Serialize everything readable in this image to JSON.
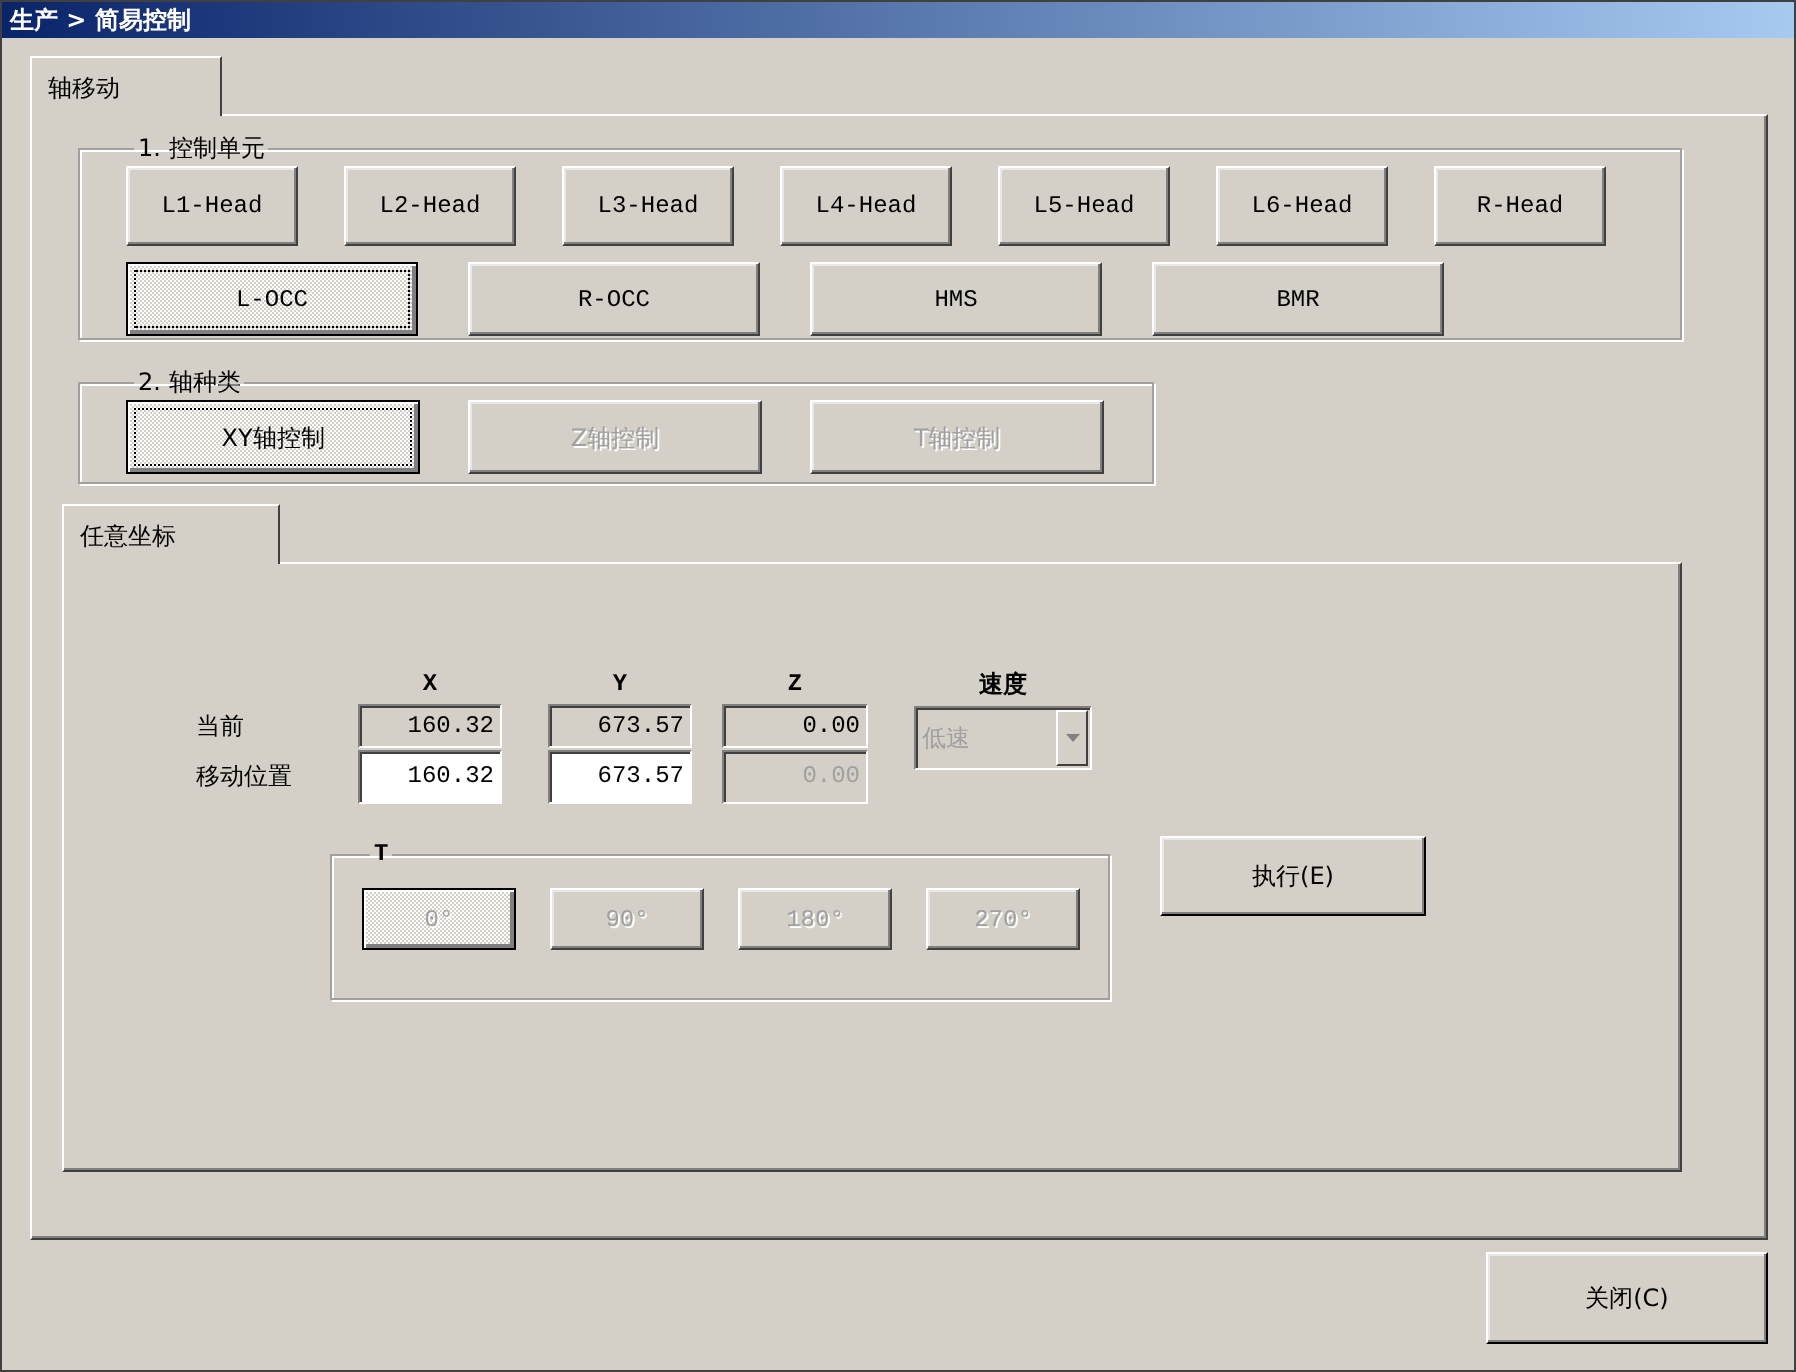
{
  "window": {
    "title": "生产 > 简易控制"
  },
  "tabs": [
    {
      "label": "轴移动",
      "selected": true
    }
  ],
  "control_unit": {
    "title": "1. 控制单元",
    "rows": [
      {
        "buttons": [
          {
            "label": "L1-Head",
            "selected": false
          },
          {
            "label": "L2-Head",
            "selected": false
          },
          {
            "label": "L3-Head",
            "selected": false
          },
          {
            "label": "L4-Head",
            "selected": false
          },
          {
            "label": "L5-Head",
            "selected": false
          },
          {
            "label": "L6-Head",
            "selected": false
          },
          {
            "label": "R-Head",
            "selected": false
          }
        ]
      },
      {
        "buttons": [
          {
            "label": "L-OCC",
            "selected": true
          },
          {
            "label": "R-OCC",
            "selected": false
          },
          {
            "label": "HMS",
            "selected": false
          },
          {
            "label": "BMR",
            "selected": false
          }
        ]
      }
    ]
  },
  "axis_type": {
    "title": "2. 轴种类",
    "buttons": [
      {
        "label": "XY轴控制",
        "selected": true,
        "disabled": false
      },
      {
        "label": "Z轴控制",
        "selected": false,
        "disabled": true
      },
      {
        "label": "T轴控制",
        "selected": false,
        "disabled": true
      }
    ]
  },
  "inner_tabs": [
    {
      "label": "任意坐标",
      "selected": true
    }
  ],
  "coordinates": {
    "columns": [
      "X",
      "Y",
      "Z"
    ],
    "row_labels": [
      "当前",
      "移动位置"
    ],
    "current": [
      {
        "value": "160.32"
      },
      {
        "value": "673.57"
      },
      {
        "value": "0.00"
      }
    ],
    "target": [
      {
        "value": "160.32",
        "disabled": false
      },
      {
        "value": "673.57",
        "disabled": false
      },
      {
        "value": "0.00",
        "disabled": true
      }
    ]
  },
  "speed": {
    "label": "速度",
    "value": "低速",
    "disabled": true
  },
  "t_group": {
    "title": "T",
    "buttons": [
      {
        "label": "0°",
        "selected": true,
        "disabled": true
      },
      {
        "label": "90°",
        "selected": false,
        "disabled": true
      },
      {
        "label": "180°",
        "selected": false,
        "disabled": true
      },
      {
        "label": "270°",
        "selected": false,
        "disabled": true
      }
    ]
  },
  "execute_button": "执行(E)",
  "close_button": "关闭(C)"
}
